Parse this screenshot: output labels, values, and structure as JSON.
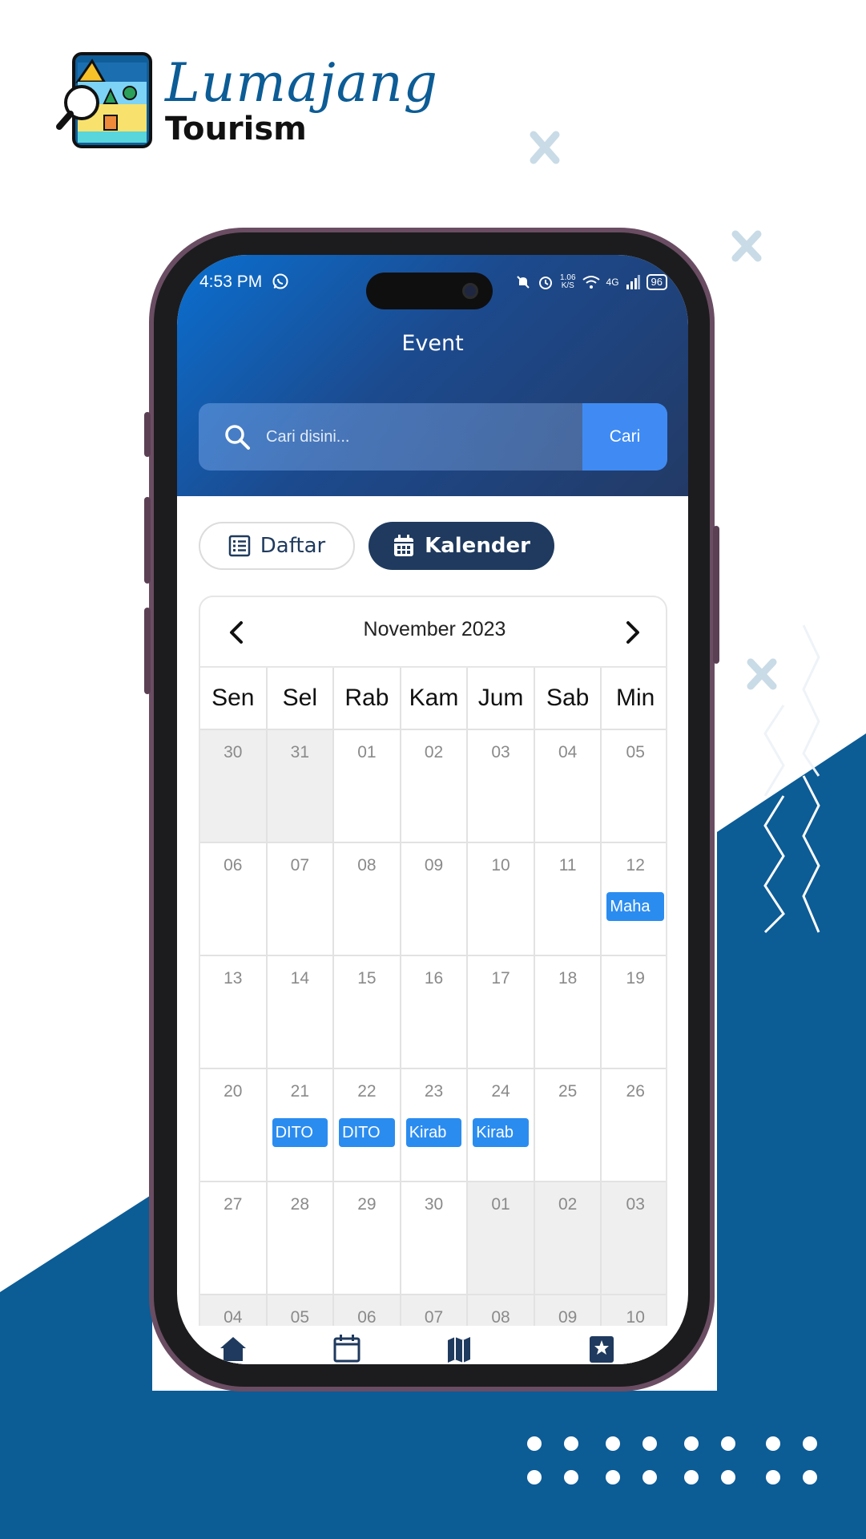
{
  "brand": {
    "script_name": "Lumajang",
    "sub_name": "Tourism"
  },
  "colors": {
    "primary_dark": "#1f3a5e",
    "header_start": "#0a6fd0",
    "header_end": "#233a66",
    "search_button": "#3f8bf3",
    "event_chip": "#2b8cf0",
    "background_blue": "#0c5c96"
  },
  "status_bar": {
    "time": "4:53 PM",
    "speed": "1.06",
    "speed_unit": "K/S",
    "network": "4G",
    "battery": "96",
    "icons": [
      "whatsapp-icon",
      "mute-icon",
      "alarm-icon",
      "wifi-icon",
      "signal-icon",
      "battery-icon"
    ]
  },
  "header": {
    "title": "Event"
  },
  "search": {
    "placeholder": "Cari disini...",
    "button_label": "Cari"
  },
  "view_toggle": {
    "list_label": "Daftar",
    "calendar_label": "Kalender",
    "active": "calendar"
  },
  "calendar": {
    "month_label": "November 2023",
    "weekdays": [
      "Sen",
      "Sel",
      "Rab",
      "Kam",
      "Jum",
      "Sab",
      "Min"
    ],
    "weeks": [
      [
        {
          "d": "30",
          "out": true
        },
        {
          "d": "31",
          "out": true
        },
        {
          "d": "01"
        },
        {
          "d": "02"
        },
        {
          "d": "03"
        },
        {
          "d": "04"
        },
        {
          "d": "05"
        }
      ],
      [
        {
          "d": "06"
        },
        {
          "d": "07"
        },
        {
          "d": "08"
        },
        {
          "d": "09"
        },
        {
          "d": "10"
        },
        {
          "d": "11"
        },
        {
          "d": "12",
          "event": "Maha"
        }
      ],
      [
        {
          "d": "13"
        },
        {
          "d": "14"
        },
        {
          "d": "15"
        },
        {
          "d": "16"
        },
        {
          "d": "17"
        },
        {
          "d": "18"
        },
        {
          "d": "19"
        }
      ],
      [
        {
          "d": "20"
        },
        {
          "d": "21",
          "event": "DITO"
        },
        {
          "d": "22",
          "event": "DITO"
        },
        {
          "d": "23",
          "event": "Kirab"
        },
        {
          "d": "24",
          "event": "Kirab"
        },
        {
          "d": "25"
        },
        {
          "d": "26"
        }
      ],
      [
        {
          "d": "27"
        },
        {
          "d": "28"
        },
        {
          "d": "29"
        },
        {
          "d": "30"
        },
        {
          "d": "01",
          "out": true
        },
        {
          "d": "02",
          "out": true
        },
        {
          "d": "03",
          "out": true
        }
      ],
      [
        {
          "d": "04",
          "out": true
        },
        {
          "d": "05",
          "out": true
        },
        {
          "d": "06",
          "out": true
        },
        {
          "d": "07",
          "out": true
        },
        {
          "d": "08",
          "out": true
        },
        {
          "d": "09",
          "out": true
        },
        {
          "d": "10",
          "out": true
        }
      ]
    ]
  },
  "bottom_nav": {
    "items": [
      "home-icon",
      "event-icon",
      "map-icon",
      "favorite-icon"
    ]
  }
}
